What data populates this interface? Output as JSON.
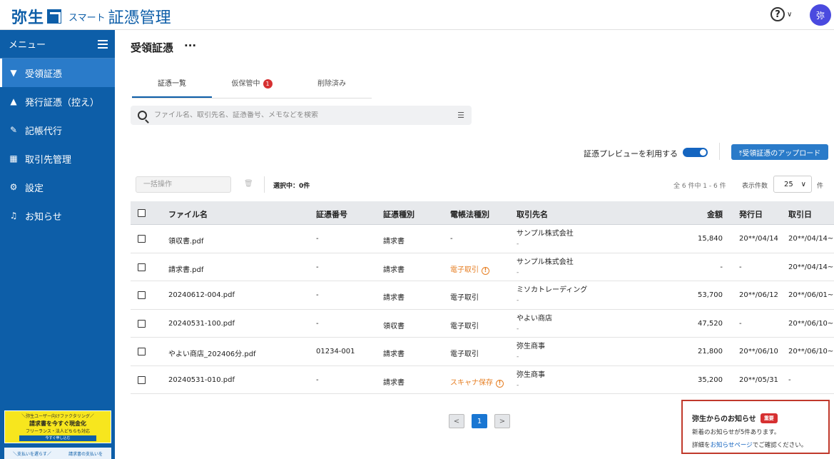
{
  "header": {
    "logo_main": "弥生",
    "logo_sub": "スマート",
    "logo_title": "証憑管理",
    "help_symbol": "?",
    "avatar_text": "弥"
  },
  "sidebar": {
    "menu_label": "メニュー",
    "items": [
      {
        "label": "受領証憑",
        "icon": "receipt-in-icon"
      },
      {
        "label": "発行証憑（控え）",
        "icon": "receipt-out-icon"
      },
      {
        "label": "記帳代行",
        "icon": "edit-icon"
      },
      {
        "label": "取引先管理",
        "icon": "building-icon"
      },
      {
        "label": "設定",
        "icon": "gear-icon"
      },
      {
        "label": "お知らせ",
        "icon": "bell-icon"
      }
    ],
    "banner1": {
      "top": "＼弥生ユーザー向けファクタリング／",
      "main": "請求書を今すぐ現金化",
      "sub": "フリーランス・法人どちらも対応",
      "button": "今すぐ申し込む"
    },
    "banner2": {
      "left": "＼支払いを遅らす／",
      "right": "請求書の支払いを"
    }
  },
  "main": {
    "title": "受領証憑",
    "more": "···",
    "tabs": [
      {
        "label": "証憑一覧"
      },
      {
        "label": "仮保管中",
        "badge": "1"
      },
      {
        "label": "削除済み"
      }
    ],
    "search_placeholder": "ファイル名、取引先名、証憑番号、メモなどを検索",
    "preview_label": "証憑プレビューを利用する",
    "upload_label": "⤒受領証憑のアップロード",
    "bulk_label": "一括操作",
    "selected_text": "選択中：0件",
    "total_text": "全 6 件中 1 - 6 件",
    "per_page_label": "表示件数",
    "per_page_value": "25",
    "per_page_unit": "件"
  },
  "table": {
    "columns": [
      "ファイル名",
      "証憑番号",
      "証憑種別",
      "電帳法種別",
      "取引先名",
      "金額",
      "発行日",
      "取引日"
    ],
    "rows": [
      {
        "file": "領収書.pdf",
        "number": "-",
        "type": "請求書",
        "law": "-",
        "law_warn": false,
        "partner": "サンプル株式会社",
        "partner_sub": "-",
        "amount": "15,840",
        "issue": "20**/04/14",
        "deal": "20**/04/14~"
      },
      {
        "file": "請求書.pdf",
        "number": "-",
        "type": "請求書",
        "law": "電子取引",
        "law_warn": true,
        "partner": "サンプル株式会社",
        "partner_sub": "-",
        "amount": "-",
        "issue": "-",
        "deal": "20**/04/14~"
      },
      {
        "file": "20240612-004.pdf",
        "number": "-",
        "type": "請求書",
        "law": "電子取引",
        "law_warn": false,
        "partner": "ミソカトレーディング",
        "partner_sub": "-",
        "amount": "53,700",
        "issue": "20**/06/12",
        "deal": "20**/06/01~"
      },
      {
        "file": "20240531-100.pdf",
        "number": "-",
        "type": "領収書",
        "law": "電子取引",
        "law_warn": false,
        "partner": "やよい商店",
        "partner_sub": "-",
        "amount": "47,520",
        "issue": "-",
        "deal": "20**/06/10~"
      },
      {
        "file": "やよい商店_202406分.pdf",
        "number": "01234-001",
        "type": "請求書",
        "law": "電子取引",
        "law_warn": false,
        "partner": "弥生商事",
        "partner_sub": "-",
        "amount": "21,800",
        "issue": "20**/06/10",
        "deal": "20**/06/10~"
      },
      {
        "file": "20240531-010.pdf",
        "number": "-",
        "type": "請求書",
        "law": "スキャナ保存",
        "law_warn": true,
        "partner": "弥生商事",
        "partner_sub": "-",
        "amount": "35,200",
        "issue": "20**/05/31",
        "deal": "-"
      }
    ]
  },
  "pagination": {
    "prev": "<",
    "current": "1",
    "next": ">"
  },
  "notice": {
    "title": "弥生からのお知らせ",
    "badge": "重要",
    "line1": "新着のお知らせが5件あります。",
    "line2_pre": "詳細を",
    "line2_link": "お知らせページ",
    "line2_post": "でご確認ください。"
  }
}
